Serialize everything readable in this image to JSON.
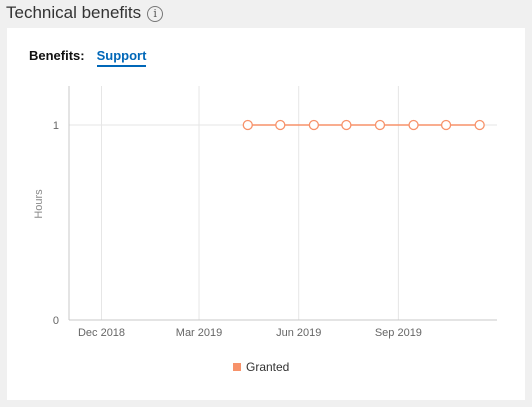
{
  "header": {
    "title": "Technical benefits",
    "info_icon": "info-icon",
    "info_glyph": "i"
  },
  "tabs": {
    "label": "Benefits:",
    "active": "Support"
  },
  "chart_data": {
    "type": "line",
    "xlabel": "",
    "ylabel": "Hours",
    "x_ticks": [
      "Dec 2018",
      "Mar 2019",
      "Jun 2019",
      "Sep 2019"
    ],
    "y_ticks": [
      0,
      1
    ],
    "ylim": [
      0,
      1.2
    ],
    "grid": true,
    "legend_position": "bottom",
    "series": [
      {
        "name": "Granted",
        "color": "#f7926a",
        "x": [
          "2019-04-15",
          "2019-05-15",
          "2019-06-15",
          "2019-07-15",
          "2019-08-15",
          "2019-09-15",
          "2019-10-15",
          "2019-11-15"
        ],
        "values": [
          1,
          1,
          1,
          1,
          1,
          1,
          1,
          1
        ]
      }
    ]
  }
}
